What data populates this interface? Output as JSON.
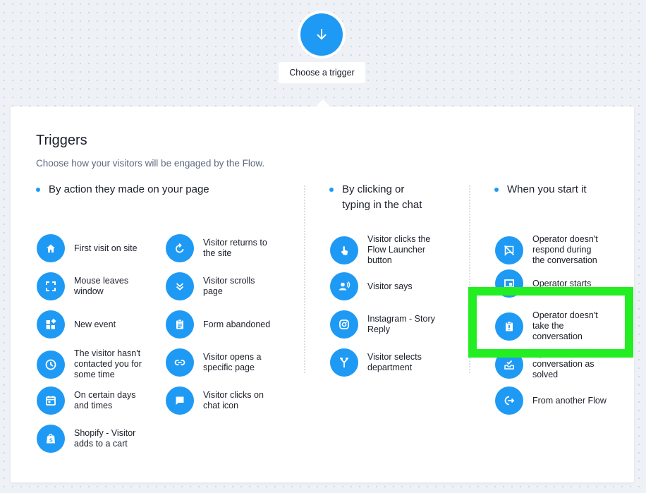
{
  "flow": {
    "start_icon": "arrow-down-icon",
    "trigger_label": "Choose a trigger"
  },
  "panel": {
    "title": "Triggers",
    "subtitle": "Choose how your visitors will be engaged by the Flow."
  },
  "sections": [
    {
      "heading": "By action they made on your page",
      "items": [
        {
          "label": "First visit on site",
          "icon": "home-icon"
        },
        {
          "label": "Mouse leaves\nwindow",
          "icon": "fullscreen-icon"
        },
        {
          "label": "New event",
          "icon": "widgets-icon"
        },
        {
          "label": "The visitor hasn't\ncontacted you for\nsome time",
          "icon": "clock-icon"
        },
        {
          "label": "On certain days\nand times",
          "icon": "calendar-icon"
        },
        {
          "label": "Shopify - Visitor\nadds to a cart",
          "icon": "shopify-bag-icon"
        },
        {
          "label": "Visitor returns to\nthe site",
          "icon": "refresh-icon"
        },
        {
          "label": "Visitor scrolls\npage",
          "icon": "double-chevron-down-icon"
        },
        {
          "label": "Form abandoned",
          "icon": "clipboard-icon"
        },
        {
          "label": "Visitor opens a\nspecific page",
          "icon": "link-icon"
        },
        {
          "label": "Visitor clicks on\nchat icon",
          "icon": "chat-bubble-icon"
        }
      ]
    },
    {
      "heading": "By clicking or\ntyping in the chat",
      "items": [
        {
          "label": "Visitor clicks the\nFlow Launcher\nbutton",
          "icon": "tap-icon"
        },
        {
          "label": "Visitor says",
          "icon": "person-voice-icon"
        },
        {
          "label": "Instagram - Story\nReply",
          "icon": "instagram-icon"
        },
        {
          "label": "Visitor selects\ndepartment",
          "icon": "fork-icon"
        }
      ]
    },
    {
      "heading": "When you start it",
      "items": [
        {
          "label": "Operator doesn't\nrespond during\nthe conversation",
          "icon": "no-chat-icon"
        },
        {
          "label": "Operator starts",
          "icon": "window-icon"
        },
        {
          "label": "Operator doesn't\ntake the\nconversation",
          "icon": "alert-clipboard-icon"
        },
        {
          "label": "Operator marks\nconversation as\nsolved",
          "icon": "inbox-check-icon"
        },
        {
          "label": "From another Flow",
          "icon": "exit-icon"
        }
      ]
    }
  ],
  "colors": {
    "accent": "#1e9af5",
    "highlight": "#22ee22",
    "text": "#1b1f2a",
    "muted": "#5e6a82"
  }
}
